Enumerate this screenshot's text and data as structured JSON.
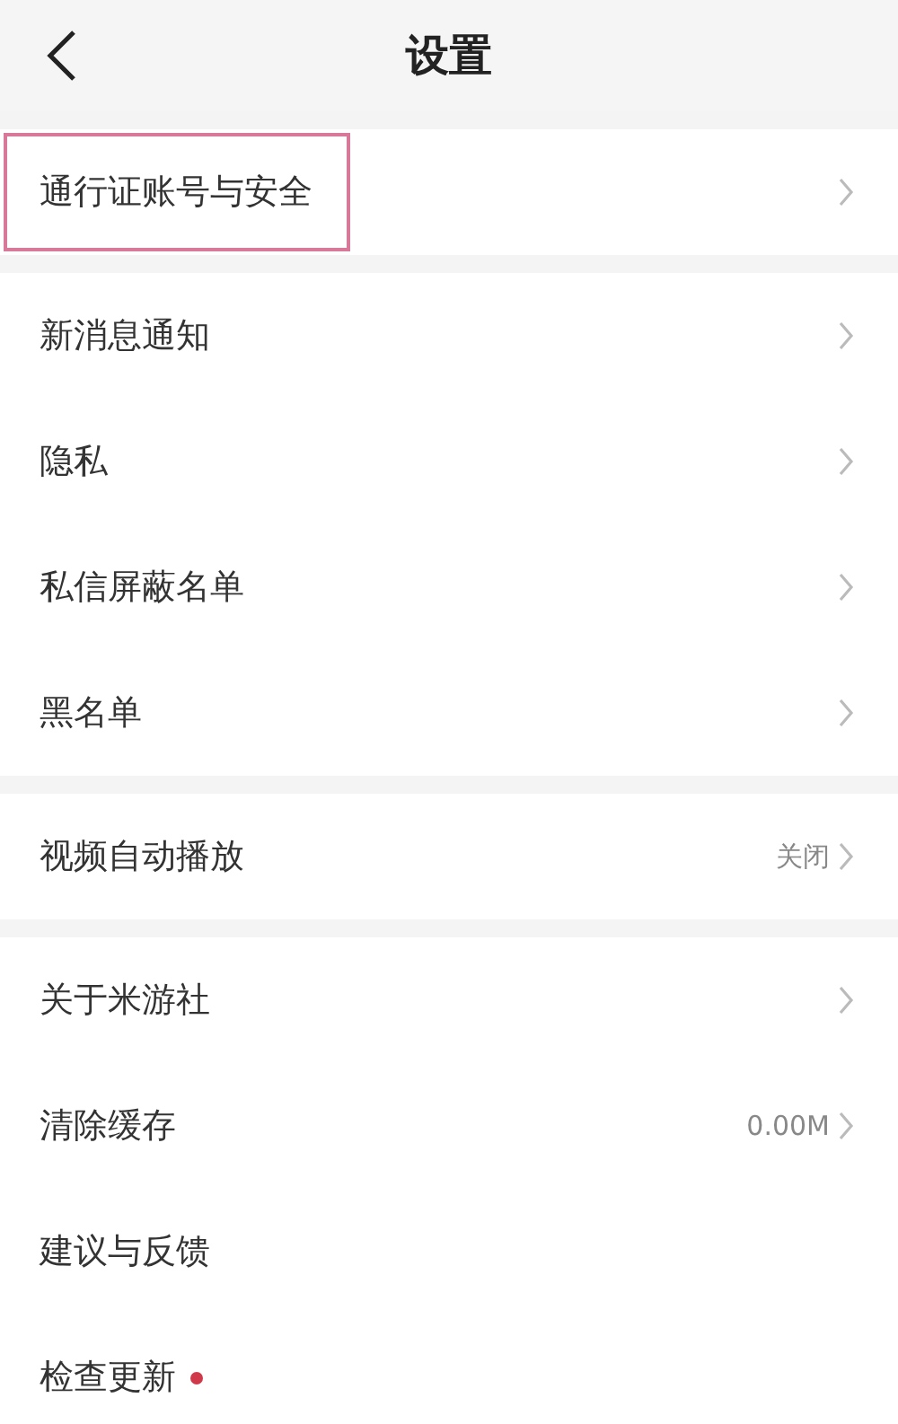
{
  "header": {
    "title": "设置"
  },
  "groups": [
    {
      "items": [
        {
          "label": "通行证账号与安全",
          "chevron": true,
          "dot": false,
          "highlighted": true
        }
      ]
    },
    {
      "items": [
        {
          "label": "新消息通知",
          "chevron": true,
          "dot": false,
          "highlighted": false
        },
        {
          "label": "隐私",
          "chevron": true,
          "dot": false,
          "highlighted": false
        },
        {
          "label": "私信屏蔽名单",
          "chevron": true,
          "dot": false,
          "highlighted": false
        },
        {
          "label": "黑名单",
          "chevron": true,
          "dot": false,
          "highlighted": false
        }
      ]
    },
    {
      "items": [
        {
          "label": "视频自动播放",
          "value": "关闭",
          "chevron": true,
          "dot": false,
          "highlighted": false
        }
      ]
    },
    {
      "items": [
        {
          "label": "关于米游社",
          "chevron": true,
          "dot": false,
          "highlighted": false
        },
        {
          "label": "清除缓存",
          "value": "0.00M",
          "chevron": true,
          "dot": false,
          "highlighted": false
        },
        {
          "label": "建议与反馈",
          "chevron": false,
          "dot": false,
          "highlighted": false
        },
        {
          "label": "检查更新",
          "chevron": false,
          "dot": true,
          "highlighted": false
        }
      ]
    }
  ]
}
